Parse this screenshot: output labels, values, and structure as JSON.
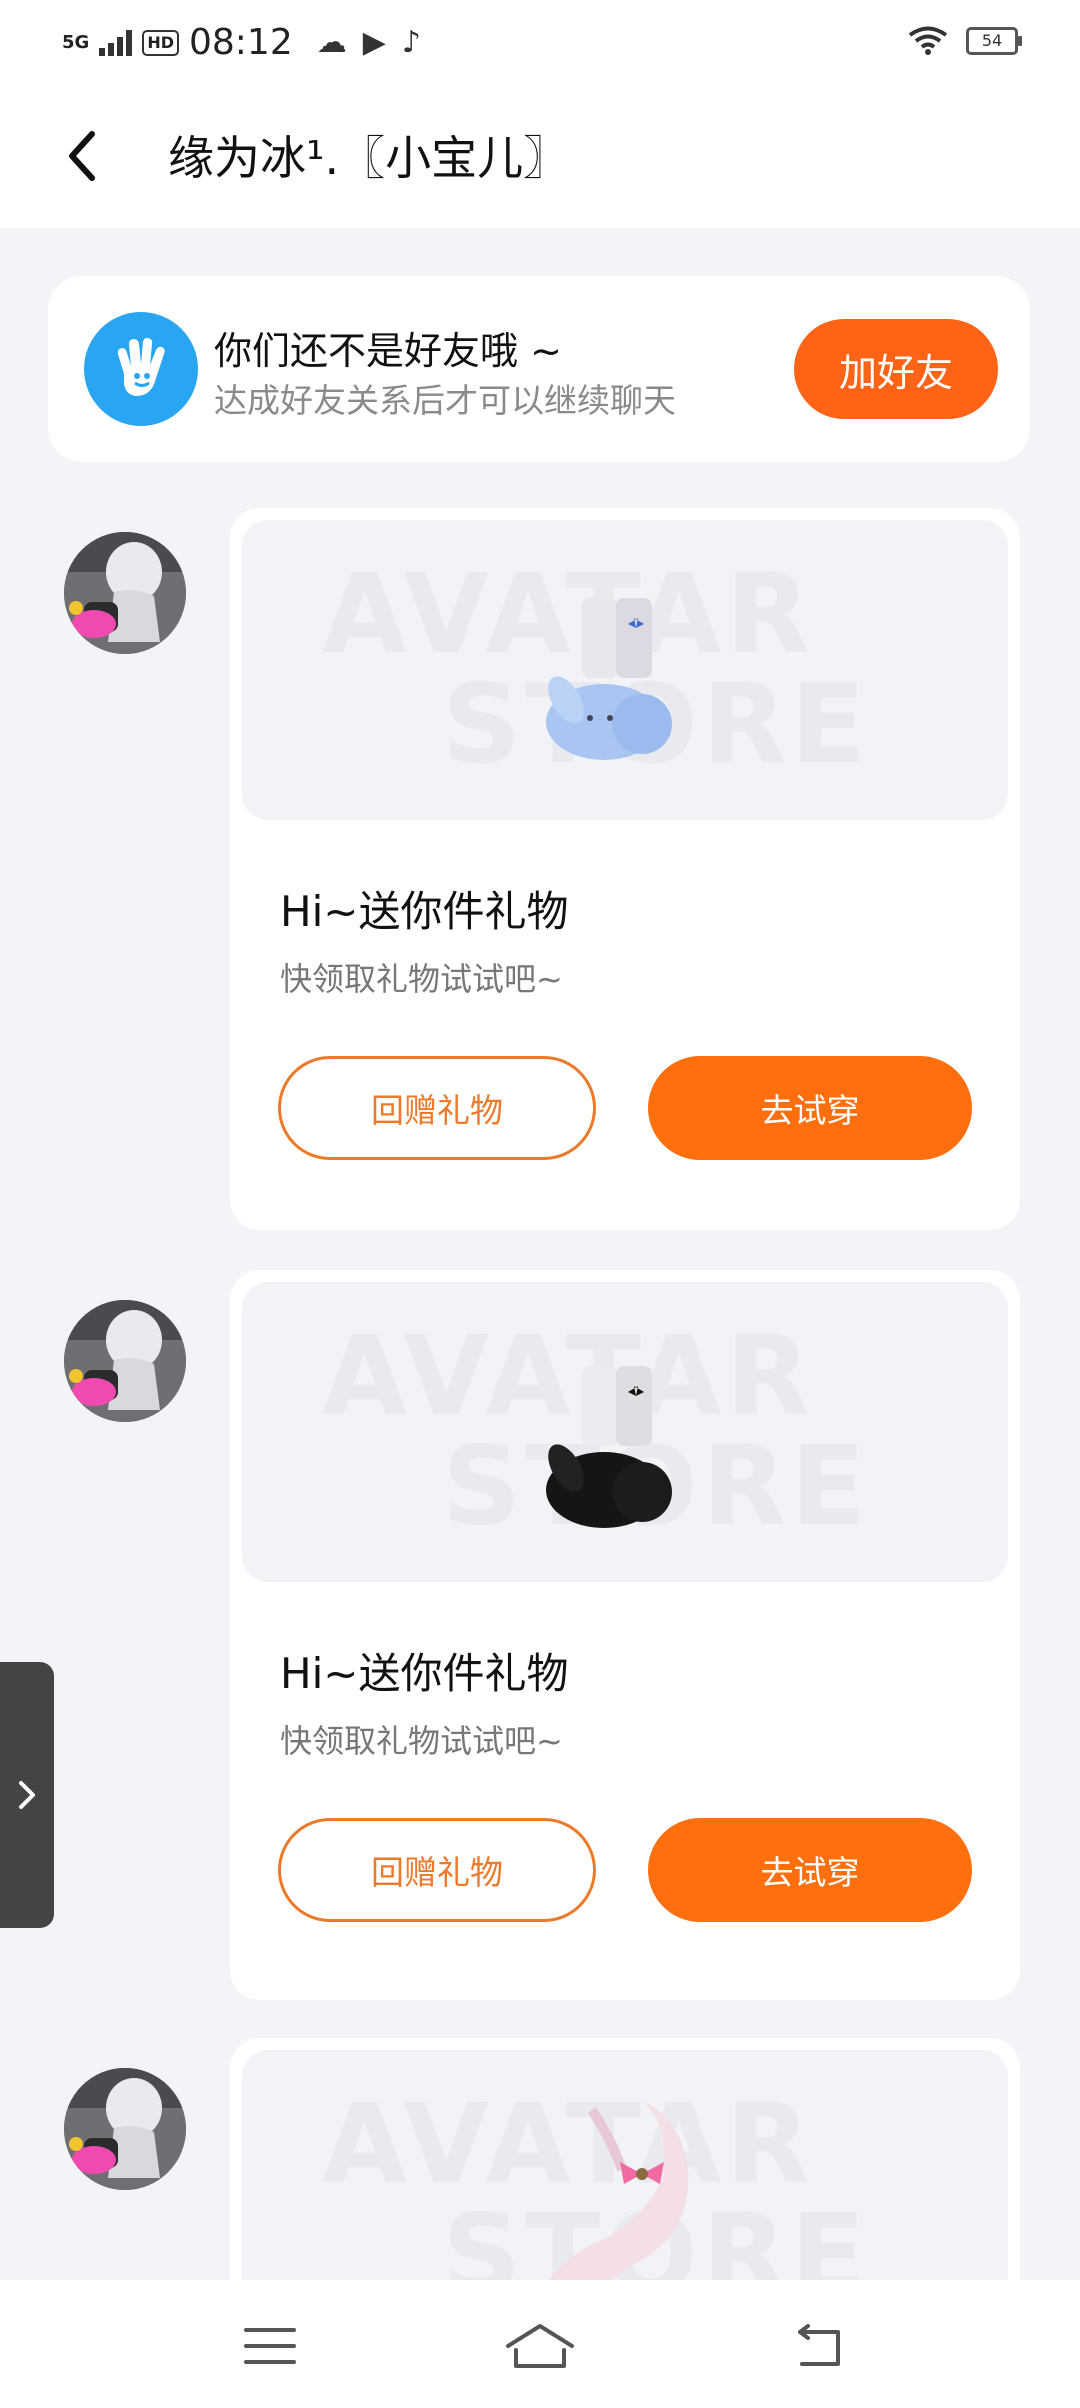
{
  "status_bar": {
    "network": "5G",
    "hd": "HD",
    "time": "08:12",
    "battery": "54"
  },
  "header": {
    "title": "缘为冰¹.〖小宝儿〗"
  },
  "friend_notice": {
    "title": "你们还不是好友哦 ~",
    "subtitle": "达成好友关系后才可以继续聊天",
    "add_button": "加好友"
  },
  "watermark": {
    "line1": "AVATAR",
    "line2": "STORE"
  },
  "messages": [
    {
      "gift_title": "Hi~送你件礼物",
      "gift_subtitle": "快领取礼物试试吧~",
      "return_gift_label": "回赠礼物",
      "try_on_label": "去试穿",
      "item_color": "#a9c6f2"
    },
    {
      "gift_title": "Hi~送你件礼物",
      "gift_subtitle": "快领取礼物试试吧~",
      "return_gift_label": "回赠礼物",
      "try_on_label": "去试穿",
      "item_color": "#151515"
    },
    {
      "item_color": "#f4dfe8"
    }
  ],
  "colors": {
    "accent": "#ff6f0e",
    "add_button": "#ff6315",
    "notice_icon": "#2aa5f2"
  },
  "icons": [
    "back-arrow-icon",
    "wave-hand-icon",
    "menu-icon",
    "home-icon",
    "return-icon",
    "chevron-right-icon"
  ]
}
